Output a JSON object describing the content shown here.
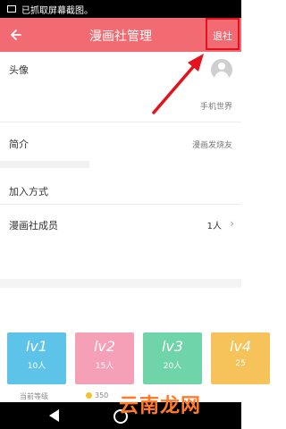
{
  "status_bar": {
    "notification": "已抓取屏幕截图。"
  },
  "app_bar": {
    "title": "漫画社管理",
    "action_label": "退社"
  },
  "profile": {
    "avatar_label": "头像",
    "name": "手机世界",
    "intro_label": "简介",
    "intro_value": "漫画发烧友",
    "join_label": "加入方式",
    "members_label": "漫画社成员",
    "members_count": "1人"
  },
  "levels": [
    {
      "label": "lv1",
      "count": "10人",
      "color": "#5ec3e8"
    },
    {
      "label": "lv2",
      "count": "15人",
      "color": "#f6a0b8"
    },
    {
      "label": "lv3",
      "count": "20人",
      "color": "#6fd4a8"
    },
    {
      "label": "lv4",
      "count": "25",
      "color": "#f5c35a"
    }
  ],
  "level_meta": {
    "current_label": "当前等级",
    "coins": "350"
  },
  "watermark": "云南龙网",
  "colors": {
    "accent": "#f26b72",
    "highlight": "#e4121f"
  },
  "icons": {
    "back": "arrow-left-icon",
    "avatar": "default-avatar-icon",
    "chevron": "chevron-right-icon"
  }
}
